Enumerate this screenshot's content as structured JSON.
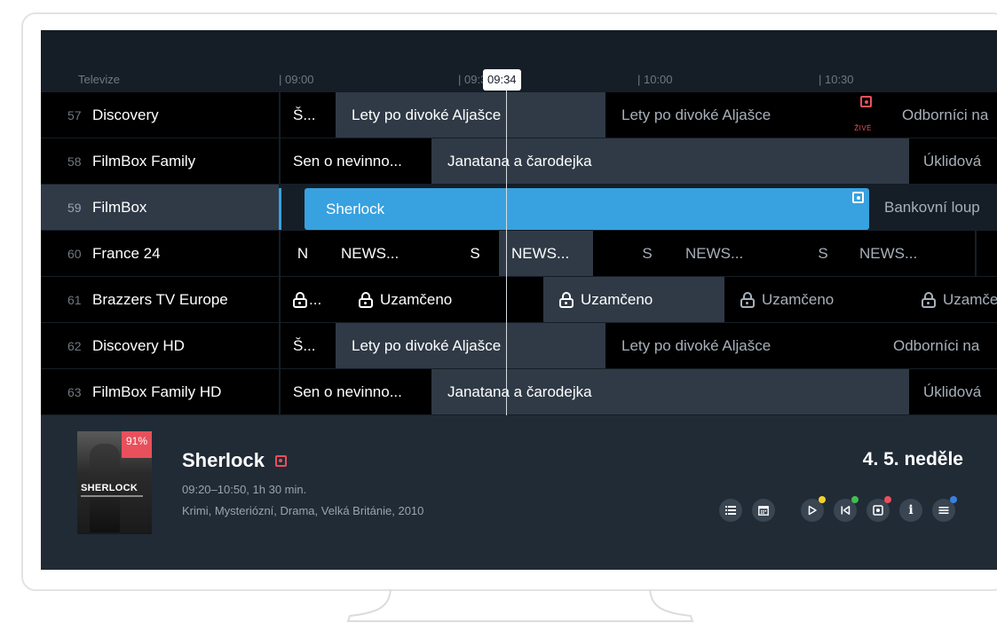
{
  "header": {
    "column_title": "Televize",
    "times": [
      "| 09:00",
      "| 09:30",
      "| 10:00",
      "| 10:30"
    ],
    "now": "09:34"
  },
  "channels": [
    {
      "number": "57",
      "name": "Discovery"
    },
    {
      "number": "58",
      "name": "FilmBox Family"
    },
    {
      "number": "59",
      "name": "FilmBox"
    },
    {
      "number": "60",
      "name": "France 24"
    },
    {
      "number": "61",
      "name": "Brazzers TV Europe"
    },
    {
      "number": "62",
      "name": "Discovery HD"
    },
    {
      "number": "63",
      "name": "FilmBox Family HD"
    }
  ],
  "programs": {
    "r57": [
      "Š...",
      "Lety po divoké Aljašce",
      "Lety po divoké Aljašce",
      "Odborníci na"
    ],
    "r58": [
      "Sen o nevinno...",
      "Janatana a čarodejka",
      "Úklidová"
    ],
    "r59": [
      "Sherlock",
      "Bankovní loup"
    ],
    "r60": [
      "N",
      "NEWS...",
      "S",
      "NEWS...",
      "S",
      "NEWS...",
      "S",
      "NEWS..."
    ],
    "r61": [
      "...",
      "Uzamčeno",
      "Uzamčeno",
      "Uzamčeno",
      "Uzamčer"
    ],
    "r62": [
      "Š...",
      "Lety po divoké Aljašce",
      "Lety po divoké Aljašce",
      "Odborníci na"
    ],
    "r63": [
      "Sen o nevinno...",
      "Janatana a čarodejka",
      "Úklidová"
    ]
  },
  "live_label": "ŽIVÉ",
  "detail": {
    "title": "Sherlock",
    "time": "09:20–10:50, 1h 30 min.",
    "genre": "Krimi, Mysteriózní, Drama, Velká Británie, 2010",
    "date": "4. 5. neděle",
    "rating": "91%",
    "poster_title": "SHERLOCK"
  },
  "colors": {
    "accent": "#38a1df",
    "record": "#e8505b",
    "yellow": "#f2d22e",
    "green": "#3fbf4f",
    "red": "#e8505b",
    "blue": "#3a7fe0"
  },
  "controls": [
    "list-icon",
    "calendar-icon",
    "play-icon",
    "restart-icon",
    "record-icon",
    "info-icon",
    "menu-icon"
  ]
}
